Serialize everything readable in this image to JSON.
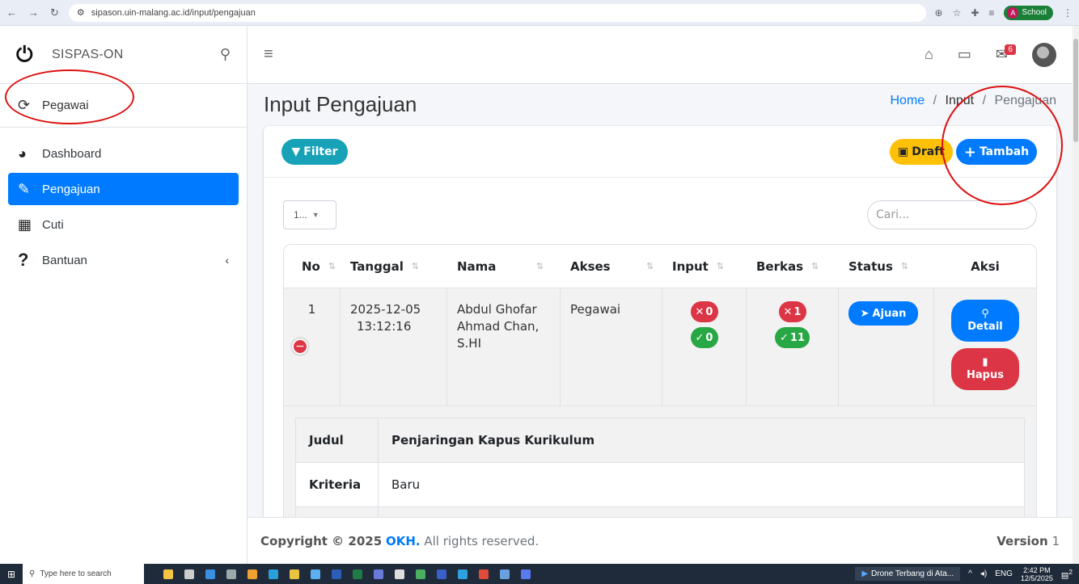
{
  "browser": {
    "url": "sipason.uin-malang.ac.id/input/pengajuan",
    "profile_label": "School",
    "profile_initial": "A"
  },
  "sidebar": {
    "brand": "SISPAS-ON",
    "user_label": "Pegawai",
    "items": [
      {
        "label": "Dashboard",
        "icon": "tachometer-icon",
        "glyph": "◕"
      },
      {
        "label": "Pengajuan",
        "icon": "edit-icon",
        "glyph": "✎"
      },
      {
        "label": "Cuti",
        "icon": "calendar-icon",
        "glyph": "▦"
      },
      {
        "label": "Bantuan",
        "icon": "question-icon",
        "glyph": "?"
      }
    ]
  },
  "navbar": {
    "mail_badge": "6"
  },
  "page": {
    "title": "Input Pengajuan",
    "breadcrumb": {
      "home": "Home",
      "sep1": "/",
      "mid": "Input",
      "sep2": "/",
      "current": "Pengajuan"
    }
  },
  "toolbar": {
    "filter_label": "Filter",
    "draft_label": "Draft",
    "tambah_label": "Tambah"
  },
  "table": {
    "length_value": "1...",
    "search_placeholder": "Cari...",
    "columns": [
      "No",
      "Tanggal",
      "Nama",
      "Akses",
      "Input",
      "Berkas",
      "Status",
      "Aksi"
    ],
    "rows": [
      {
        "no": "1",
        "tanggal_date": "2025-12-05",
        "tanggal_time": "13:12:16",
        "nama": "Abdul Ghofar Ahmad Chan, S.HI",
        "akses": "Pegawai",
        "input_x": "0",
        "input_check": "0",
        "berkas_x": "1",
        "berkas_check": "11",
        "status_label": "Ajuan",
        "detail_label": "Detail",
        "hapus_label": "Hapus"
      }
    ]
  },
  "detail": {
    "rows": [
      {
        "key": "Judul",
        "value": "Penjaringan Kapus Kurikulum"
      },
      {
        "key": "Kriteria",
        "value": "Baru"
      }
    ]
  },
  "footer": {
    "copyright_prefix": "Copyright © 2025",
    "org": "OKH.",
    "suffix": "All rights reserved.",
    "version_label": "Version",
    "version_number": "1"
  },
  "taskbar": {
    "search_placeholder": "Type here to search",
    "task_label": "Drone Terbang di Ata...",
    "lang": "ENG",
    "time": "2:42 PM",
    "date": "12/5/2025",
    "notif_count": "2"
  },
  "colors": {
    "primary": "#007bff",
    "info": "#17a2b8",
    "warning": "#ffc107",
    "danger": "#dc3545",
    "success": "#28a745",
    "annotation": "#dd1111"
  }
}
